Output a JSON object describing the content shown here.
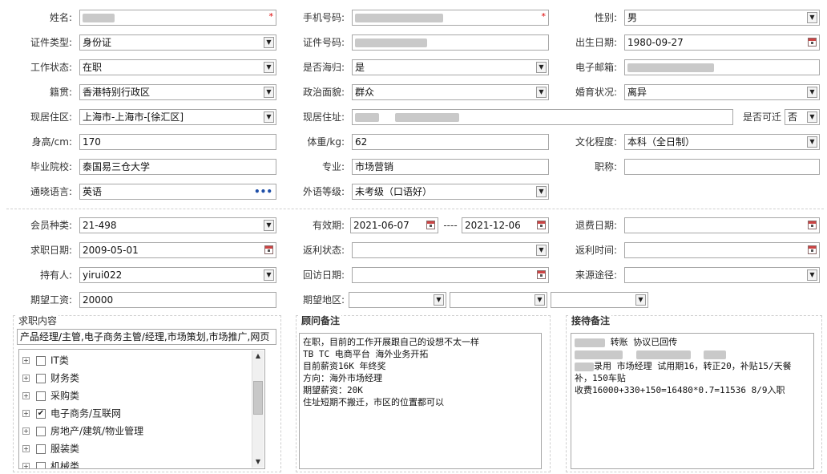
{
  "row1": {
    "name_label": "姓名:",
    "phone_label": "手机号码:",
    "gender_label": "性别:",
    "gender_value": "男"
  },
  "row2": {
    "idtype_label": "证件类型:",
    "idtype_value": "身份证",
    "idno_label": "证件号码:",
    "birth_label": "出生日期:",
    "birth_value": "1980-09-27"
  },
  "row3": {
    "work_label": "工作状态:",
    "work_value": "在职",
    "overseas_label": "是否海归:",
    "overseas_value": "是",
    "email_label": "电子邮箱:"
  },
  "row4": {
    "native_label": "籍贯:",
    "native_value": "香港特别行政区",
    "political_label": "政治面貌:",
    "political_value": "群众",
    "marital_label": "婚育状况:",
    "marital_value": "离异"
  },
  "row5": {
    "area_label": "现居住区:",
    "area_value": "上海市-上海市-[徐汇区]",
    "address_label": "现居住址:",
    "relocate_label": "是否可迁",
    "relocate_value": "否"
  },
  "row6": {
    "height_label": "身高/cm:",
    "height_value": "170",
    "weight_label": "体重/kg:",
    "weight_value": "62",
    "edu_label": "文化程度:",
    "edu_value": "本科（全日制）"
  },
  "row7": {
    "school_label": "毕业院校:",
    "school_value": "泰国易三仓大学",
    "major_label": "专业:",
    "major_value": "市场营销",
    "title_label": "职称:",
    "title_value": ""
  },
  "row8": {
    "lang_label": "通晓语言:",
    "lang_value": "英语",
    "lang_more": "•••",
    "flevel_label": "外语等级:",
    "flevel_value": "未考级（口语好）"
  },
  "row9": {
    "member_label": "会员种类:",
    "member_value": "21-498",
    "valid_label": "有效期:",
    "valid_from": "2021-06-07",
    "valid_dash": "----",
    "valid_to": "2021-12-06",
    "refund_label": "退费日期:"
  },
  "row10": {
    "jobdate_label": "求职日期:",
    "jobdate_value": "2009-05-01",
    "rebate_status_label": "返利状态:",
    "rebate_time_label": "返利时间:"
  },
  "row11": {
    "holder_label": "持有人:",
    "holder_value": "yirui022",
    "visit_label": "回访日期:",
    "source_label": "来源途径:"
  },
  "row12": {
    "salary_label": "期望工资:",
    "salary_value": "20000",
    "region_label": "期望地区:"
  },
  "jobs": {
    "title": "求职内容",
    "summary": "产品经理/主管,电子商务主管/经理,市场策划,市场推广,网页",
    "items": [
      {
        "label": "IT类",
        "checked": ""
      },
      {
        "label": "财务类",
        "checked": ""
      },
      {
        "label": "采购类",
        "checked": ""
      },
      {
        "label": "电子商务/互联网",
        "checked": "✔"
      },
      {
        "label": "房地产/建筑/物业管理",
        "checked": ""
      },
      {
        "label": "服装类",
        "checked": ""
      },
      {
        "label": "机械类",
        "checked": ""
      }
    ],
    "expand_glyph": "+"
  },
  "advisor": {
    "title": "顾问备注",
    "lines": [
      "在职，目前的工作开展跟自己的设想不太一样",
      "TB TC 电商平台 海外业务开拓",
      "目前薪资16K  年终奖",
      "方向：海外市场经理",
      "期望薪资：20K",
      "住址短期不搬迁，市区的位置都可以"
    ]
  },
  "reception": {
    "title": "接待备注",
    "line1": "转账 协议已回传",
    "line3": "录用 市场经理 试用期16，转正20，补贴15/天餐",
    "line4": "补，150车贴",
    "line5": "收费16000+330+150=16480*0.7=11536  8/9入职"
  },
  "icons": {
    "dropdown": "▼",
    "required": "*",
    "scroll_up": "▲",
    "scroll_down": "▼"
  }
}
